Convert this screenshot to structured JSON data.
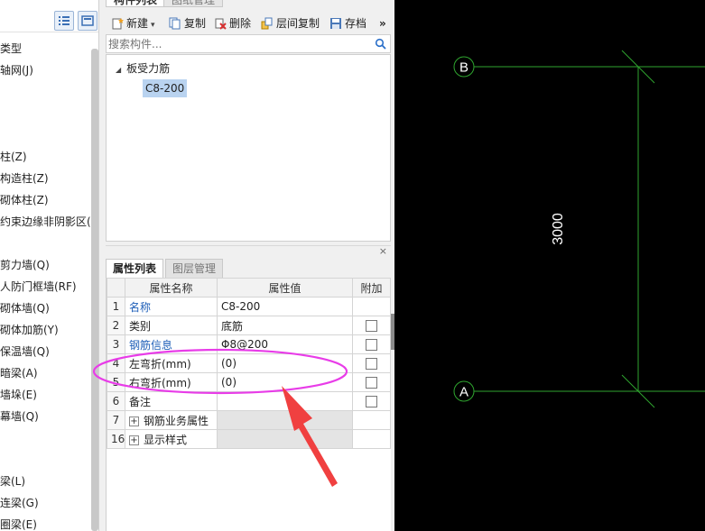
{
  "left_tree": {
    "items": [
      "类型",
      "轴网(J)",
      "柱(Z)",
      "构造柱(Z)",
      "砌体柱(Z)",
      "约束边缘非阴影区(Z",
      "剪力墙(Q)",
      "人防门框墙(RF)",
      "砌体墙(Q)",
      "砌体加筋(Y)",
      "保温墙(Q)",
      "暗梁(A)",
      "墙垛(E)",
      "幕墙(Q)",
      "梁(L)",
      "连梁(G)",
      "圈梁(E)"
    ]
  },
  "component_panel": {
    "tabs": [
      "构件列表",
      "图纸管理"
    ],
    "toolbar": {
      "new_label": "新建",
      "copy_label": "复制",
      "delete_label": "删除",
      "floor_copy_label": "层间复制",
      "save_label": "存档",
      "more_label": "»"
    },
    "search_placeholder": "搜索构件...",
    "tree": {
      "group": "板受力筋",
      "item": "C8-200"
    }
  },
  "properties": {
    "tabs": [
      "属性列表",
      "图层管理"
    ],
    "close_label": "×",
    "headers": [
      "属性名称",
      "属性值",
      "附加"
    ],
    "rows": [
      {
        "idx": "1",
        "name": "名称",
        "value": "C8-200",
        "link": true,
        "checkbox": false
      },
      {
        "idx": "2",
        "name": "类别",
        "value": "底筋",
        "link": false,
        "checkbox": true
      },
      {
        "idx": "3",
        "name": "钢筋信息",
        "value": "Φ8@200",
        "link": true,
        "checkbox": true
      },
      {
        "idx": "4",
        "name": "左弯折(mm)",
        "value": "(0)",
        "link": false,
        "checkbox": true
      },
      {
        "idx": "5",
        "name": "右弯折(mm)",
        "value": "(0)",
        "link": false,
        "checkbox": true
      },
      {
        "idx": "6",
        "name": "备注",
        "value": "",
        "link": false,
        "checkbox": true
      },
      {
        "idx": "7",
        "name": "钢筋业务属性",
        "value": "",
        "expand": true
      },
      {
        "idx": "16",
        "name": "显示样式",
        "value": "",
        "expand": true
      }
    ]
  },
  "canvas": {
    "axis_top": "B",
    "axis_bottom": "A",
    "dimension": "3000",
    "line_color": "#2fa52f",
    "background": "#000000"
  },
  "annotation_color": "#e83ce8",
  "arrow_color": "#f04040"
}
